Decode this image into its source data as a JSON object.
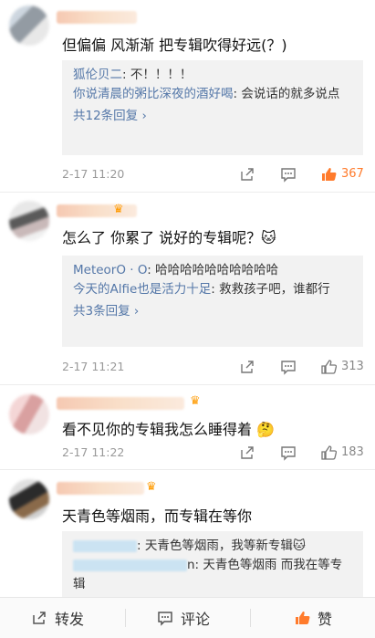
{
  "comments": [
    {
      "text": "但偏偏 风渐渐 把专辑吹得好远(？)",
      "replies": [
        {
          "user": "狐伦贝二",
          "sep": ": ",
          "text": "不！！！！"
        },
        {
          "user": "你说清晨的粥比深夜的酒好喝",
          "sep": ": ",
          "text": "会说话的就多说点"
        }
      ],
      "more": "共12条回复 ›",
      "time": "2-17 11:20",
      "likes": "367"
    },
    {
      "text": "怎么了 你累了 说好的专辑呢？🐱",
      "replies": [
        {
          "user": "MeteorO · O",
          "sep": ": ",
          "text": "哈哈哈哈哈哈哈哈哈哈"
        },
        {
          "user": "今天的Alfie也是活力十足",
          "sep": ": ",
          "text": "救救孩子吧，谁都行"
        }
      ],
      "more": "共3条回复 ›",
      "time": "2-17 11:21",
      "likes": "313"
    },
    {
      "text": "看不见你的专辑我怎么睡得着 🤔",
      "time": "2-17 11:22",
      "likes": "183"
    },
    {
      "text": "天青色等烟雨，而专辑在等你",
      "replies": [
        {
          "sep": ": ",
          "text": "天青色等烟雨，我等新专辑🐱"
        },
        {
          "sep": "n: ",
          "text": "天青色等烟雨 而我在等专辑"
        }
      ]
    }
  ],
  "bottom_bar": {
    "share": "转发",
    "comment": "评论",
    "like": "赞"
  },
  "colors": {
    "accent_like": "#ff7b2c",
    "link_blue": "#5477a8"
  }
}
